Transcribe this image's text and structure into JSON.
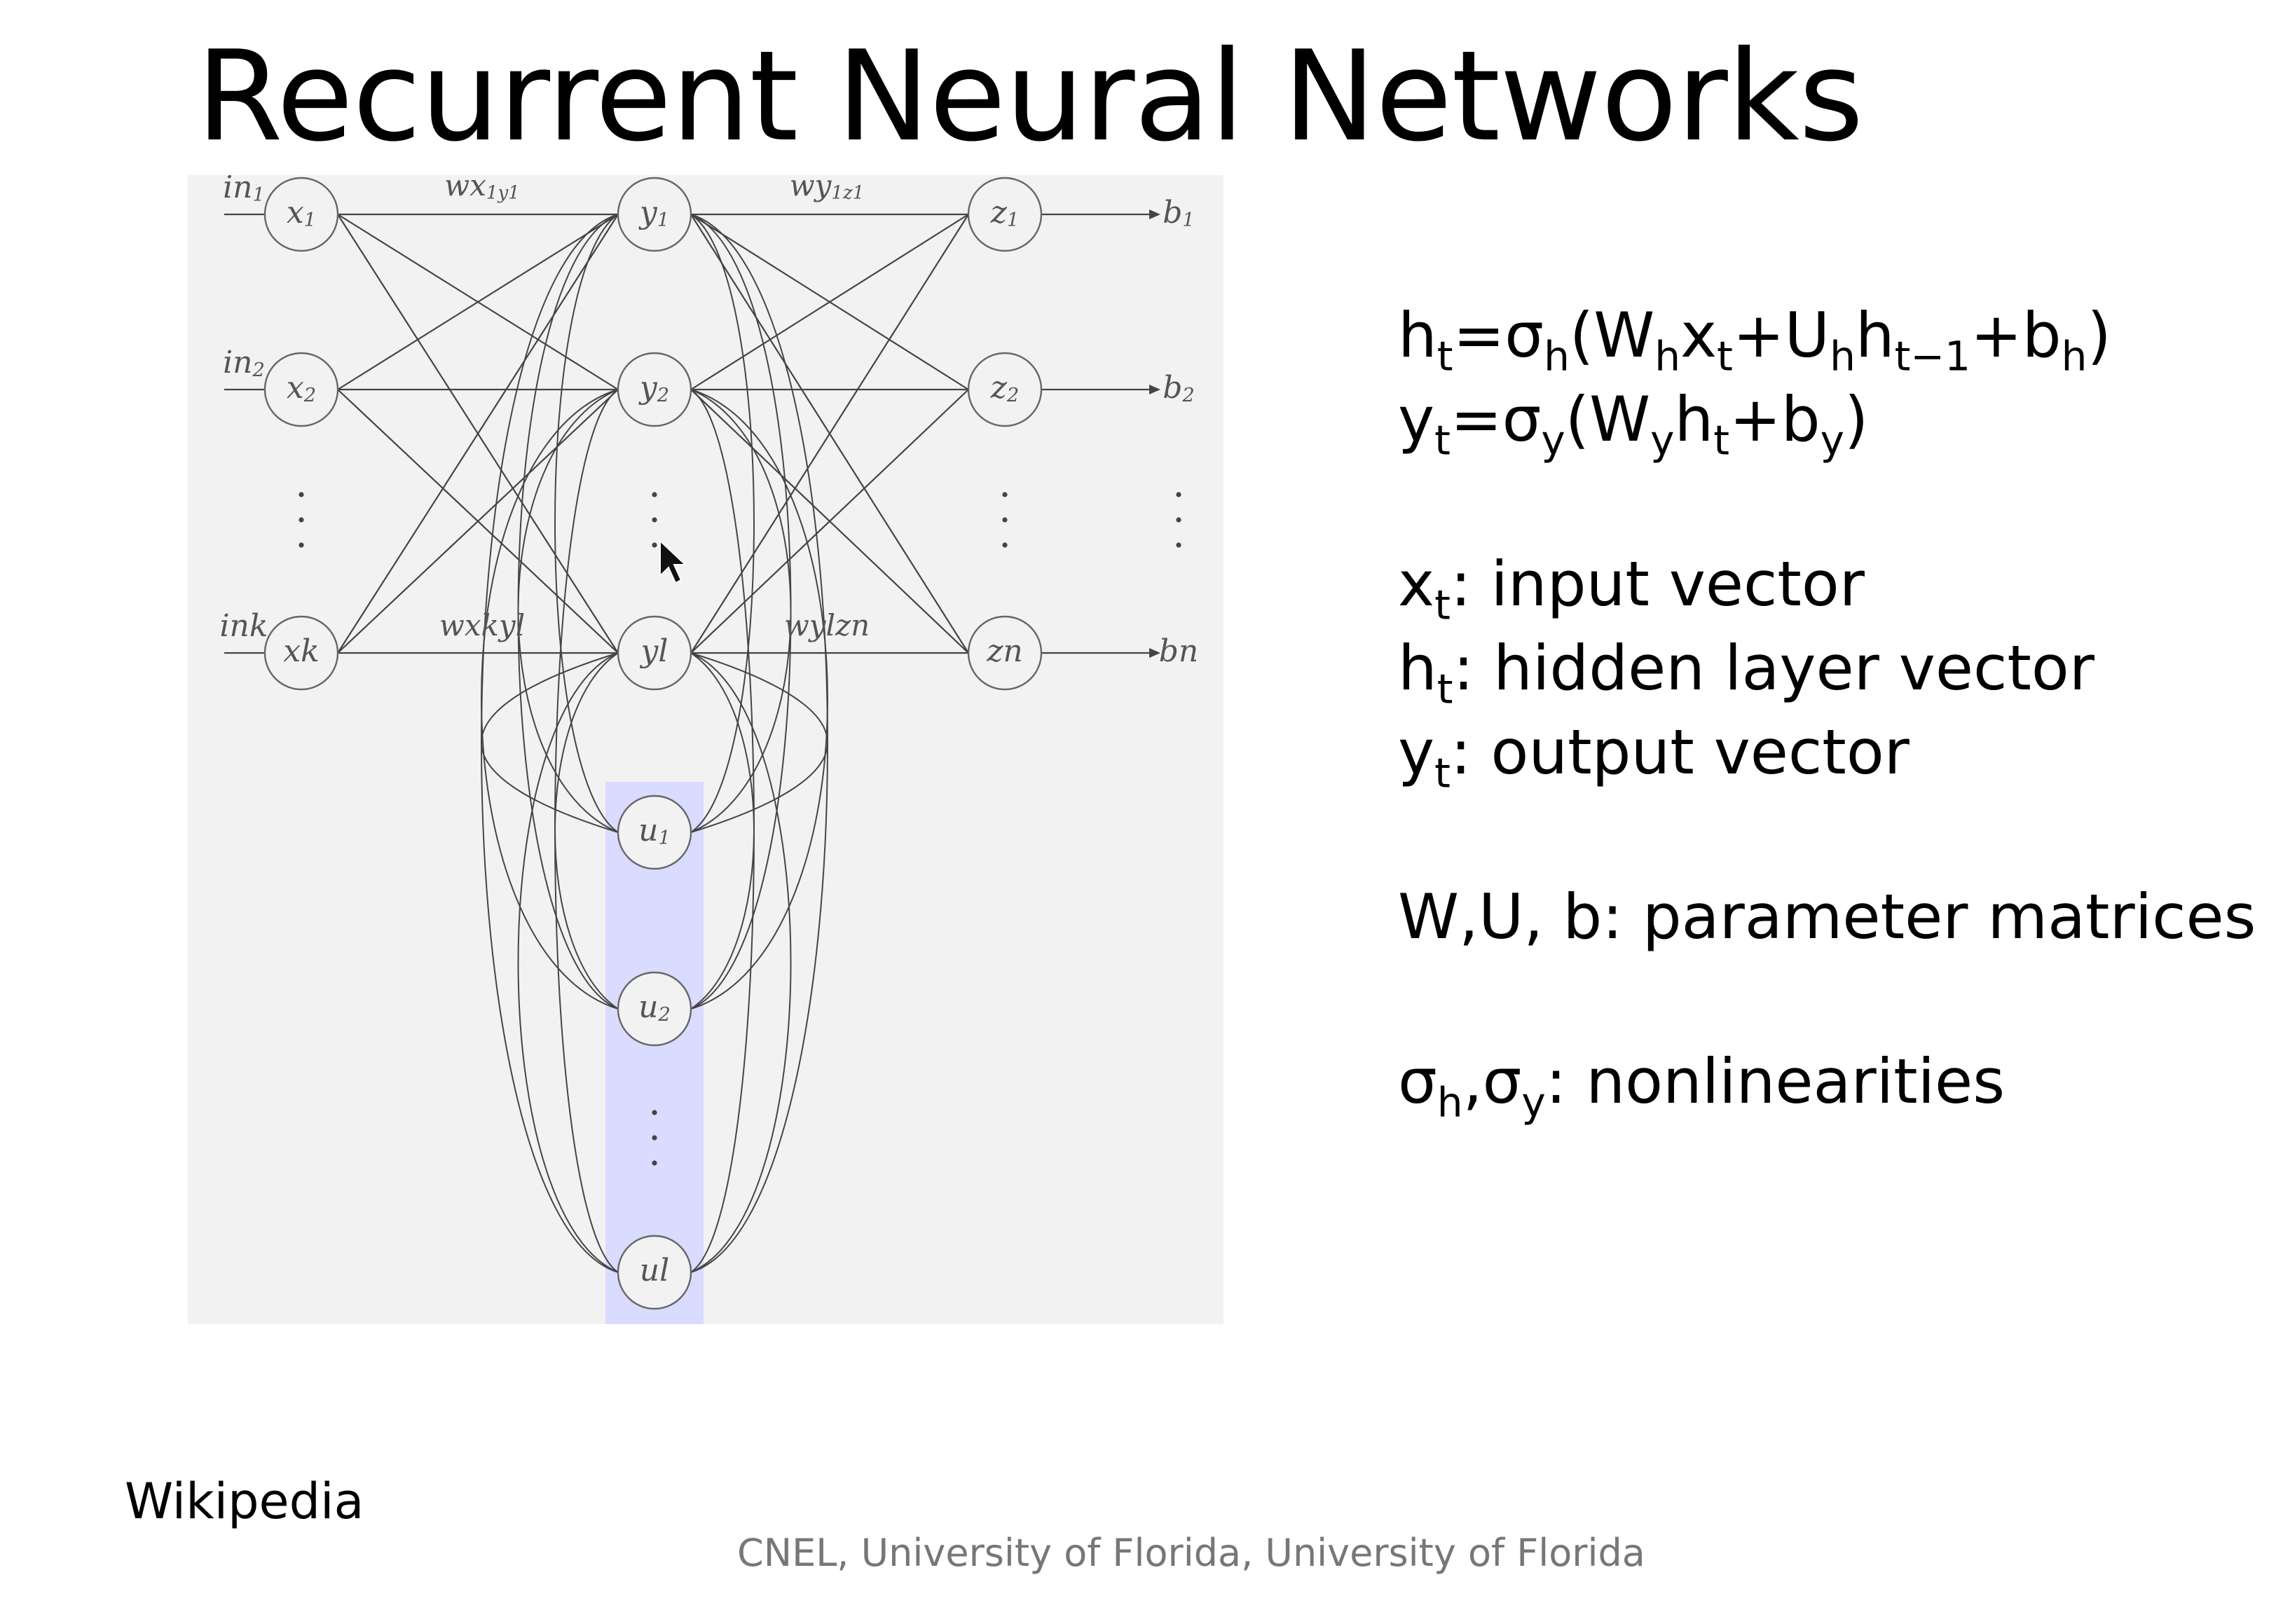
{
  "slide": {
    "title": "Recurrent Neural Networks",
    "source": "Wikipedia",
    "footer": "CNEL, University of Florida, University of Florida"
  },
  "diagram": {
    "input_labels": [
      "in1",
      "in2",
      "ink"
    ],
    "x_nodes": [
      "x1",
      "x2",
      "xk"
    ],
    "y_nodes": [
      "y1",
      "y2",
      "yl"
    ],
    "z_nodes": [
      "z1",
      "z2",
      "zn"
    ],
    "output_labels": [
      "b1",
      "b2",
      "bn"
    ],
    "u_nodes": [
      "u1",
      "u2",
      "ul"
    ],
    "weight_labels": [
      "wx1y1",
      "wy1z1",
      "wxkyl",
      "wylzn"
    ],
    "context_highlight_color": "#d9dbff"
  },
  "equations": {
    "h_eq": [
      "h",
      "t",
      "=σ",
      "h",
      "(W",
      "h",
      "x",
      "t",
      "+U",
      "h",
      "h",
      "t−1",
      "+b",
      "h",
      ")"
    ],
    "y_eq": [
      "y",
      "t",
      "=σ",
      "y",
      "(W",
      "y",
      "h",
      "t",
      "+b",
      "y",
      ")"
    ],
    "x_def": [
      "x",
      "t",
      ": input vector"
    ],
    "h_def": [
      "h",
      "t",
      ": hidden layer vector"
    ],
    "y_def": [
      "y",
      "t",
      ": output vector"
    ],
    "params": "W,U, b: parameter matrices",
    "sigma_def": [
      "σ",
      "h",
      ",σ",
      "y",
      ": nonlinearities"
    ]
  }
}
